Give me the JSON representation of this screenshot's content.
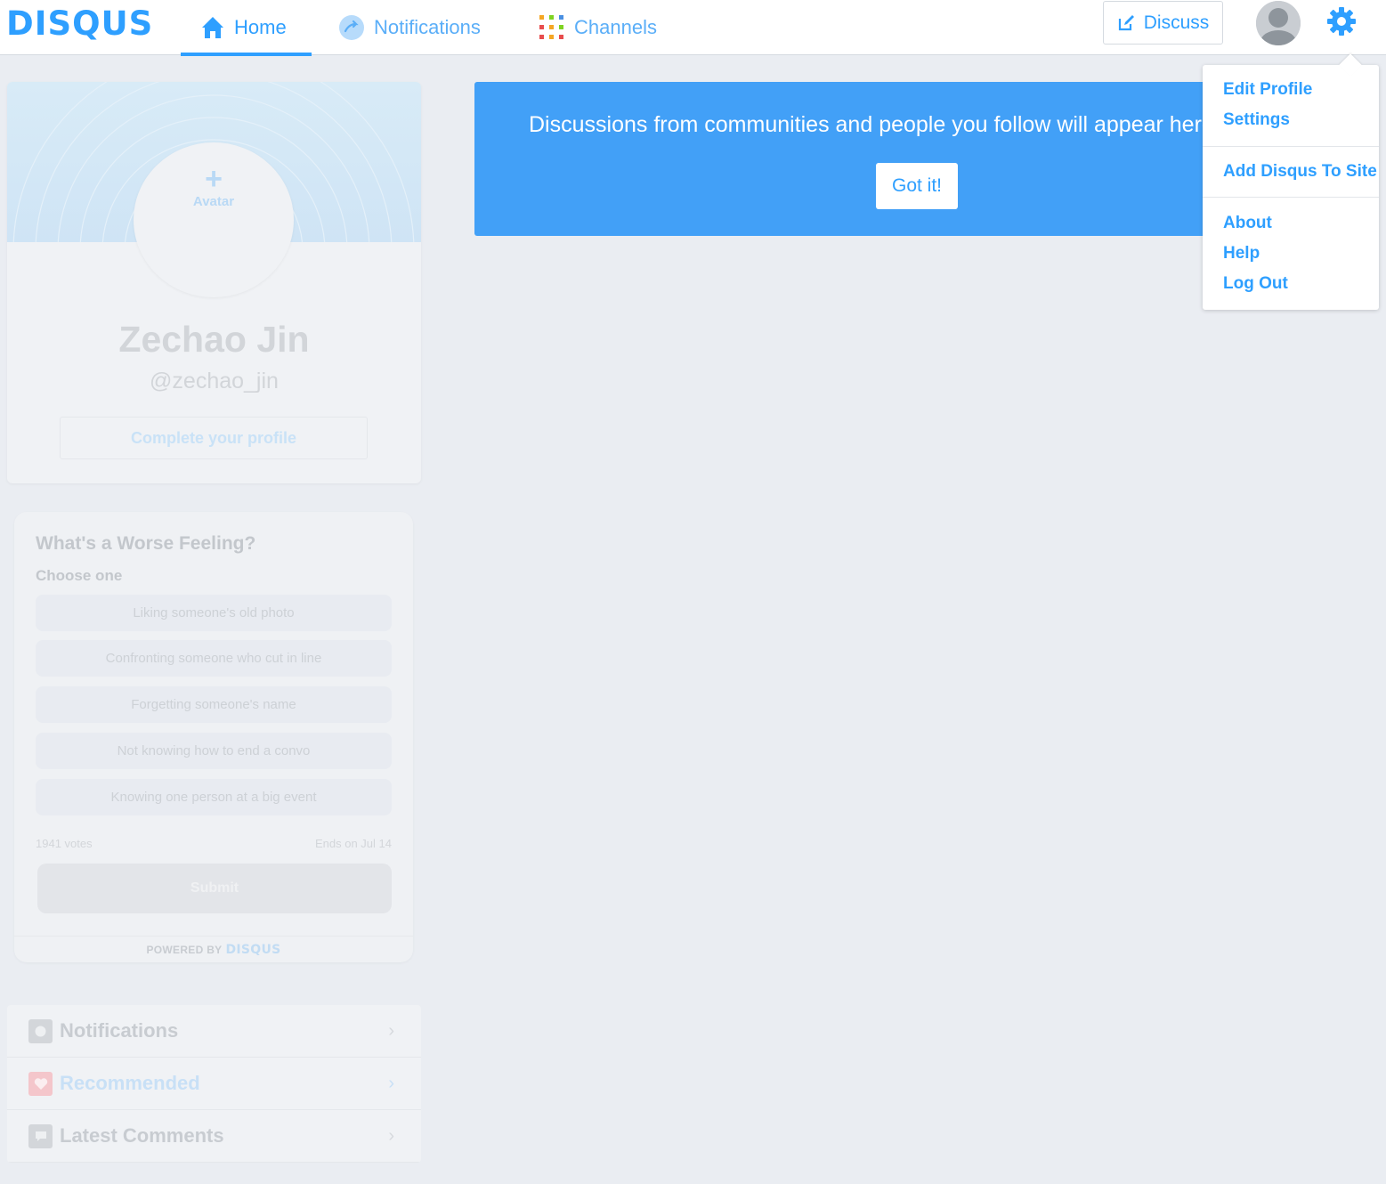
{
  "brand": {
    "logo": "DISQUS",
    "accent": "#2e9fff"
  },
  "nav": {
    "home": "Home",
    "notifications": "Notifications",
    "channels": "Channels",
    "discuss": "Discuss"
  },
  "dropdown": {
    "items": [
      "Edit Profile",
      "Settings",
      "Add Disqus To Site",
      "About",
      "Help",
      "Log Out"
    ]
  },
  "banner": {
    "text": "Discussions from communities and people you follow will appear here i",
    "button": "Got it!"
  },
  "profile": {
    "avatar_label": "Avatar",
    "avatar_plus": "+",
    "name": "Zechao Jin",
    "handle": "@zechao_jin",
    "complete": "Complete your profile"
  },
  "poll": {
    "title": "What's a Worse Feeling?",
    "subtitle": "Choose one",
    "options": [
      "Liking someone's old photo",
      "Confronting someone who cut in line",
      "Forgetting someone's name",
      "Not knowing how to end a convo",
      "Knowing one person at a big event"
    ],
    "votes": "1941 votes",
    "ends": "Ends on Jul 14",
    "submit": "Submit",
    "powered_by": "POWERED BY",
    "powered_brand": "DISQUS"
  },
  "sidelist": {
    "items": [
      {
        "label": "Notifications",
        "icon": "notifications-icon"
      },
      {
        "label": "Recommended",
        "icon": "heart-icon"
      },
      {
        "label": "Latest Comments",
        "icon": "comment-icon"
      }
    ]
  }
}
